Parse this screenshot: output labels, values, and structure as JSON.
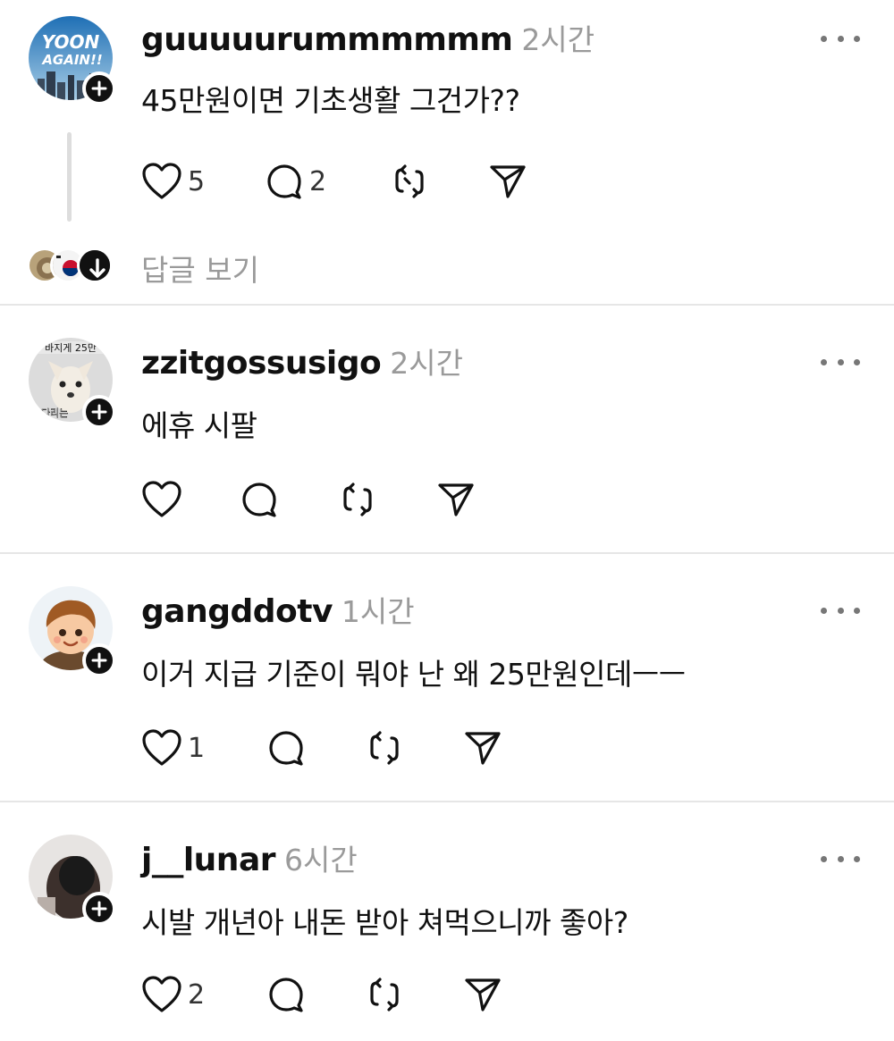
{
  "posts": [
    {
      "username": "guuuuurummmmmm",
      "time": "2시간",
      "text": "45만원이면 기초생활 그건가??",
      "likes": "5",
      "comments": "2",
      "avatar_text": "YOON AGAIN!!"
    },
    {
      "username": "zzitgossusigo",
      "time": "2시간",
      "text": "에휴 시팔",
      "likes": "",
      "comments": "",
      "avatar_text_top": "바지게 25만",
      "avatar_text_bottom": "다리는"
    },
    {
      "username": "gangddotv",
      "time": "1시간",
      "text": "이거 지급 기준이 뭐야 난 왜 25만원인데ㅡㅡ",
      "likes": "1",
      "comments": ""
    },
    {
      "username": "j__lunar",
      "time": "6시간",
      "text": "시발 개년아 내돈 받아 쳐먹으니까 좋아?",
      "likes": "2",
      "comments": ""
    }
  ],
  "replies": {
    "label": "답글 보기"
  },
  "icons": {
    "like": "heart-icon",
    "comment": "comment-icon",
    "repost": "repost-icon",
    "share": "send-icon",
    "more": "more-icon",
    "follow": "plus-icon",
    "expand": "arrow-down-icon"
  },
  "colors": {
    "text": "#111111",
    "muted": "#9a9a9a",
    "divider": "#e6e6e6",
    "badge": "#111111"
  }
}
